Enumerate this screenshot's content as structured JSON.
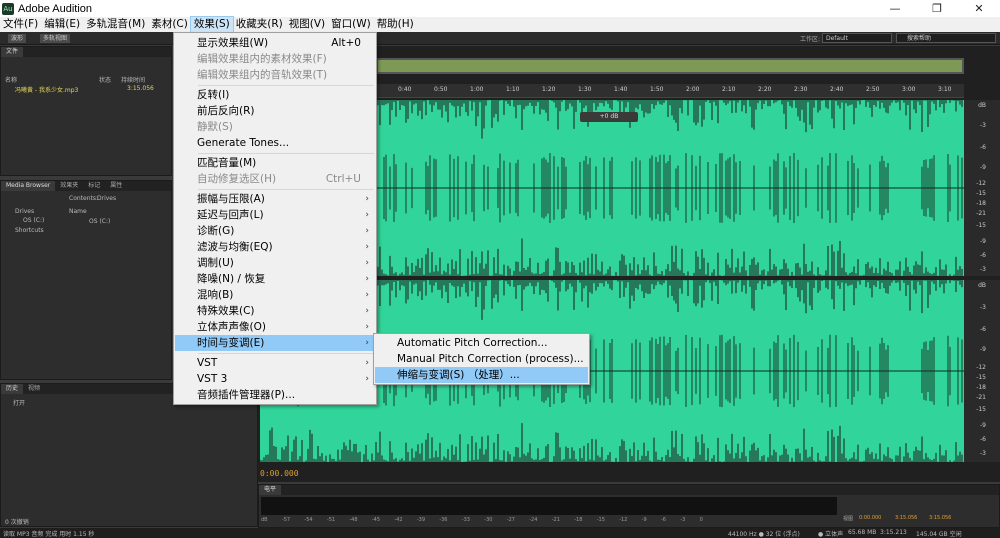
{
  "window": {
    "title": "Adobe Audition",
    "app_icon": "Au",
    "controls": {
      "minimize": "—",
      "maximize": "❐",
      "close": "✕"
    }
  },
  "menubar": {
    "items": [
      "文件(F)",
      "编辑(E)",
      "多轨混音(M)",
      "素材(C)",
      "效果(S)",
      "收藏夹(R)",
      "视图(V)",
      "窗口(W)",
      "帮助(H)"
    ]
  },
  "toolbar": {
    "waveform": "波形",
    "multitrack": "多轨视图",
    "workspace_label": "工作区:",
    "workspace_value": "Default",
    "help_search": "搜索帮助"
  },
  "files_panel": {
    "tab": "文件",
    "columns": [
      "名称",
      "状态",
      "持续时间"
    ],
    "file_name": "冯曦黄 - 我系少女.mp3",
    "file_duration": "3:15.056"
  },
  "media_panel": {
    "tabs": [
      "Media Browser",
      "效果夹",
      "标记",
      "属性"
    ],
    "contents_label": "Contents:",
    "contents_value": "Drives",
    "tree": [
      "Drives",
      "OS (C:)",
      "Shortcuts"
    ],
    "name_col": "Name",
    "right_item": "OS (C:)"
  },
  "history_panel": {
    "tabs": [
      "历史",
      "视频"
    ],
    "item": "打开",
    "undo_count": "0 次撤销"
  },
  "editor": {
    "ruler_ticks": [
      "0:40",
      "0:50",
      "1:00",
      "1:10",
      "1:20",
      "1:30",
      "1:40",
      "1:50",
      "2:00",
      "2:10",
      "2:20",
      "2:30",
      "2:40",
      "2:50",
      "3:00",
      "3:10"
    ],
    "db_top": [
      "dB",
      "-3",
      "-6",
      "-9",
      "-12",
      "-15",
      "-18",
      "-21",
      "-15",
      "-9",
      "-6",
      "-3"
    ],
    "db_bottom": [
      "dB",
      "-3",
      "-6",
      "-9",
      "-12",
      "-15",
      "-18",
      "-21",
      "-15",
      "-9",
      "-6",
      "-3"
    ],
    "hud_gain": "+0 dB",
    "current_time": "0:00.000",
    "wave_color": "#31d49a"
  },
  "level_panel": {
    "tab": "电平",
    "scale": [
      "dB",
      "-57",
      "-54",
      "-51",
      "-48",
      "-45",
      "-42",
      "-39",
      "-36",
      "-33",
      "-30",
      "-27",
      "-24",
      "-21",
      "-18",
      "-15",
      "-12",
      "-9",
      "-6",
      "-3",
      "0"
    ]
  },
  "selection_panel": {
    "view_label": "视图",
    "start": "0:00.000",
    "end": "3:15.056",
    "duration": "3:15.056"
  },
  "statusbar": {
    "left": "读取 MP3 音频 完成 用时 1.15 秒",
    "format": "44100 Hz ● 32 位 (浮点)",
    "channels": "● 立体声",
    "size": "65.68 MB",
    "duration": "3:15.213",
    "free": "145.04 GB 空闲"
  },
  "effects_menu": {
    "items": [
      {
        "label": "显示效果组(W)",
        "shortcut": "Alt+0",
        "disabled": false
      },
      {
        "label": "编辑效果组内的素材效果(F)",
        "disabled": true
      },
      {
        "label": "编辑效果组内的音轨效果(T)",
        "disabled": true
      },
      {
        "label": "反转(I)",
        "disabled": false
      },
      {
        "label": "前后反向(R)",
        "disabled": false
      },
      {
        "label": "静默(S)",
        "disabled": true
      },
      {
        "label": "Generate Tones...",
        "disabled": false
      },
      {
        "label": "匹配音量(M)",
        "disabled": false
      },
      {
        "label": "自动修复选区(H)",
        "shortcut": "Ctrl+U",
        "disabled": true
      },
      {
        "label": "振幅与压限(A)",
        "submenu": true
      },
      {
        "label": "延迟与回声(L)",
        "submenu": true
      },
      {
        "label": "诊断(G)",
        "submenu": true
      },
      {
        "label": "滤波与均衡(EQ)",
        "submenu": true
      },
      {
        "label": "调制(U)",
        "submenu": true
      },
      {
        "label": "降噪(N) / 恢复",
        "submenu": true
      },
      {
        "label": "混响(B)",
        "submenu": true
      },
      {
        "label": "特殊效果(C)",
        "submenu": true
      },
      {
        "label": "立体声声像(O)",
        "submenu": true
      },
      {
        "label": "时间与变调(E)",
        "submenu": true,
        "highlighted": true
      },
      {
        "label": "VST",
        "submenu": true
      },
      {
        "label": "VST 3",
        "submenu": true
      },
      {
        "label": "音频插件管理器(P)..."
      }
    ]
  },
  "time_pitch_submenu": {
    "items": [
      {
        "label": "Automatic Pitch Correction..."
      },
      {
        "label": "Manual Pitch Correction (process)..."
      },
      {
        "label": "伸缩与变调(S) （处理）...",
        "highlighted": true
      }
    ]
  }
}
